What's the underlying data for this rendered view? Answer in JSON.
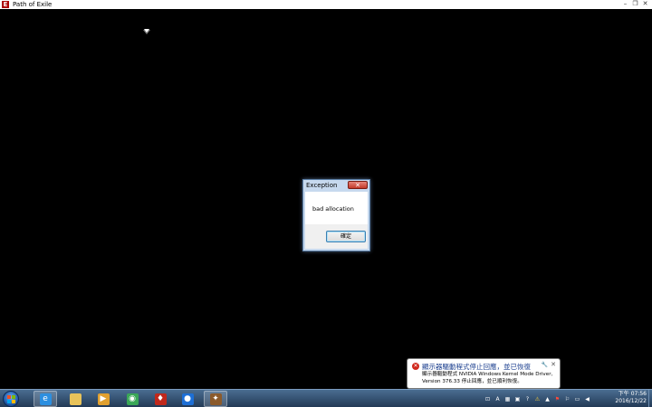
{
  "window": {
    "title": "Path of Exile",
    "icon_letter": "E",
    "minimize": "–",
    "restore": "❐",
    "close": "✕"
  },
  "dialog": {
    "title": "Exception",
    "close_glyph": "✕",
    "message": "bad allocation",
    "ok_label": "確定"
  },
  "balloon": {
    "title": "顯示器驅動程式停止回應，並已恢復",
    "text_line1": "顯示器驅動程式 NVIDIA Windows Kernel Mode Driver,",
    "text_line2": "Version 376.33  停止回應，並已順利恢復。",
    "options_glyph": "🔧",
    "close_glyph": "✕",
    "error_glyph": "✕"
  },
  "taskbar": {
    "items": [
      {
        "name": "internet-explorer",
        "color": "#2c8fe0",
        "glyph": "e"
      },
      {
        "name": "file-explorer",
        "color": "#e8c35a",
        "glyph": ""
      },
      {
        "name": "media-player",
        "color": "#e0a030",
        "glyph": "▶"
      },
      {
        "name": "chrome",
        "color": "#3aa757",
        "glyph": "◉"
      },
      {
        "name": "red-app",
        "color": "#c0281c",
        "glyph": "♦"
      },
      {
        "name": "blue-app",
        "color": "#1d6fd6",
        "glyph": "●"
      },
      {
        "name": "path-of-exile",
        "color": "#8b5a2b",
        "glyph": "✦"
      }
    ]
  },
  "tray": {
    "icons": [
      "⊡",
      "A",
      "▦",
      "▣",
      "?",
      "⚠",
      "▲",
      "⚑",
      "⚐",
      "▭",
      "◀"
    ]
  },
  "clock": {
    "time": "下午 07:56",
    "date": "2016/12/22"
  }
}
